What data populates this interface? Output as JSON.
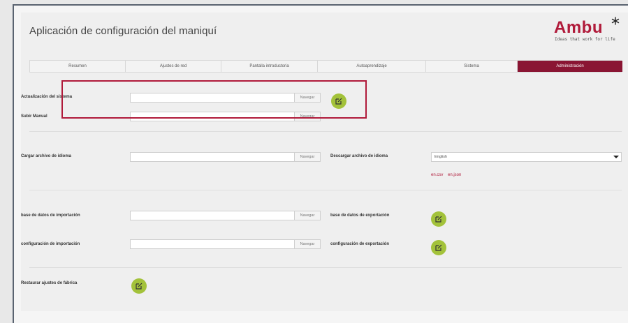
{
  "header": {
    "title": "Aplicación de configuración del maniquí",
    "logo_text": "Ambu",
    "logo_tagline": "Ideas that work for life"
  },
  "tabs": [
    {
      "label": "Resumen",
      "active": false
    },
    {
      "label": "Ajustes de red",
      "active": false
    },
    {
      "label": "Pantalla introductoria",
      "active": false
    },
    {
      "label": "Autoaprendizaje",
      "active": false
    },
    {
      "label": "Sistema",
      "active": false
    },
    {
      "label": "Administración",
      "active": true
    }
  ],
  "sections": {
    "system_update_label": "Actualización del sistema",
    "manual_upload_label": "Subir Manual",
    "language_upload_label": "Cargar archivo de idioma",
    "language_download_label": "Descargar archivo de idioma",
    "language_selected": "English",
    "language_links": [
      "en.csv",
      "en.json"
    ],
    "db_import_label": "base de datos de importación",
    "db_export_label": "base de datos de exportación",
    "config_import_label": "configuración de importación",
    "config_export_label": "configuración de exportación",
    "factory_reset_label": "Restaurar ajustes de fábrica",
    "browse_label": "Navegar"
  },
  "colors": {
    "brand": "#b01a3a",
    "active_tab": "#8a1533",
    "action_button": "#a3c23a"
  }
}
